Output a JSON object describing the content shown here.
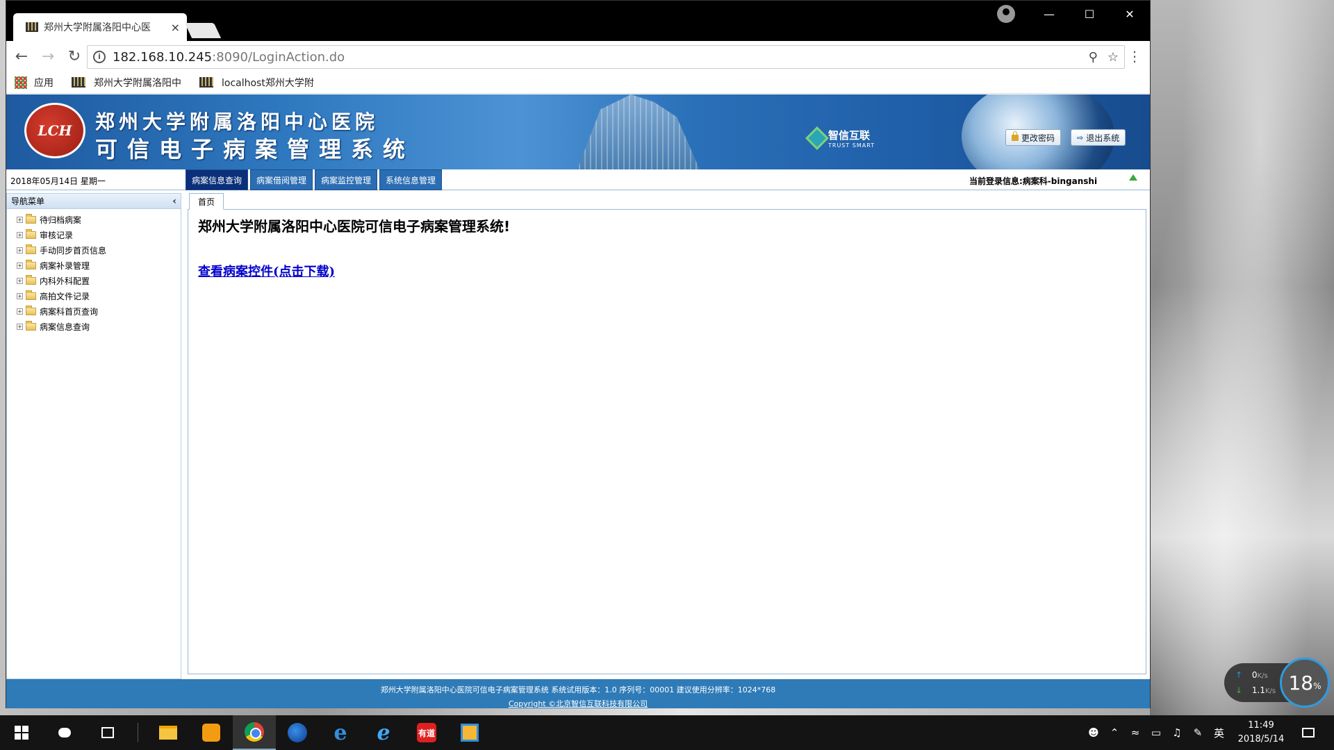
{
  "browser": {
    "tab_title": "郑州大学附属洛阳中心医",
    "tab_close": "×",
    "url_host": "182.168.10.245",
    "url_path": ":8090/LoginAction.do",
    "bookmarks": {
      "apps": "应用",
      "items": [
        "郑州大学附属洛阳中",
        "localhost郑州大学附"
      ]
    }
  },
  "header": {
    "logo_text": "LCH",
    "hospital_name": "郑州大学附属洛阳中心医院",
    "system_name": "可信电子病案管理系统",
    "partner_name": "智信互联",
    "partner_sub": "TRUST SMART",
    "change_password": "更改密码",
    "logout": "退出系统"
  },
  "subbar": {
    "date": "2018年05月14日 星期一",
    "menu_tabs": [
      "病案信息查询",
      "病案借阅管理",
      "病案监控管理",
      "系统信息管理"
    ],
    "active_tab_index": 0,
    "login_info": "当前登录信息:病案科-binganshi"
  },
  "sidebar": {
    "title": "导航菜单",
    "items": [
      "待归档病案",
      "审核记录",
      "手动同步首页信息",
      "病案补录管理",
      "内科外科配置",
      "高拍文件记录",
      "病案科首页查询",
      "病案信息查询"
    ]
  },
  "content": {
    "tab_label": "首页",
    "welcome": "郑州大学附属洛阳中心医院可信电子病案管理系统!",
    "download_link": "查看病案控件(点击下载)"
  },
  "footer": {
    "line1": "郑州大学附属洛阳中心医院可信电子病案管理系统 系统试用版本：1.0 序列号：00001 建议使用分辨率：1024*768",
    "line2": "Copyright ©北京智信互联科技有限公司"
  },
  "net_widget": {
    "up_value": "0",
    "up_unit": "K/s",
    "down_value": "1.1",
    "down_unit": "K/s",
    "percent": "18",
    "percent_unit": "%"
  },
  "taskbar": {
    "youdao_label": "有道",
    "ime": "英",
    "time": "11:49",
    "date": "2018/5/14"
  },
  "colors": {
    "header_blue": "#2f79c0",
    "menu_tab": "#2a6db3",
    "menu_tab_active": "#0b2f7a",
    "footer": "#2e7bb8",
    "link": "#0000cc"
  }
}
